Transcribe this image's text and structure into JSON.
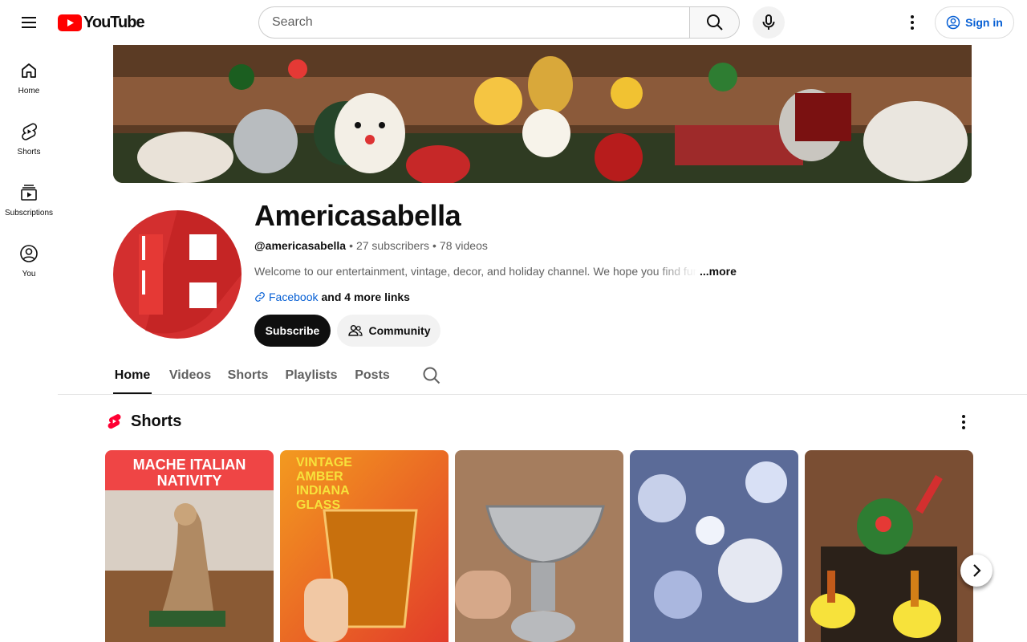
{
  "masthead": {
    "logo_text": "YouTube",
    "search_placeholder": "Search",
    "signin_label": "Sign in",
    "brand_color": "#ff0000",
    "link_color": "#065fd4"
  },
  "guide": {
    "items": [
      {
        "label": "Home",
        "icon": "home-icon"
      },
      {
        "label": "Shorts",
        "icon": "shorts-icon"
      },
      {
        "label": "Subscriptions",
        "icon": "subscriptions-icon"
      },
      {
        "label": "You",
        "icon": "account-circle-icon"
      }
    ]
  },
  "channel": {
    "name": "Americasabella",
    "handle": "@americasabella",
    "dot": "•",
    "subscribers": "27 subscribers",
    "videos": "78 videos",
    "description": "Welcome to our entertainment, vintage, decor, and holiday channel. We hope you find funny",
    "more_label": "...more",
    "link_label": "Facebook",
    "more_links": "and 4 more links",
    "subscribe_label": "Subscribe",
    "community_label": "Community"
  },
  "tabs": [
    {
      "label": "Home",
      "active": true
    },
    {
      "label": "Videos",
      "active": false
    },
    {
      "label": "Shorts",
      "active": false
    },
    {
      "label": "Playlists",
      "active": false
    },
    {
      "label": "Posts",
      "active": false
    }
  ],
  "shorts_shelf": {
    "title": "Shorts",
    "items": [
      {
        "thumb_text": "MACHE ITALIAN NATIVITY"
      },
      {
        "thumb_text": "VINTAGE AMBER INDIANA GLASS"
      },
      {
        "thumb_text": ""
      },
      {
        "thumb_text": ""
      },
      {
        "thumb_text": ""
      }
    ]
  }
}
